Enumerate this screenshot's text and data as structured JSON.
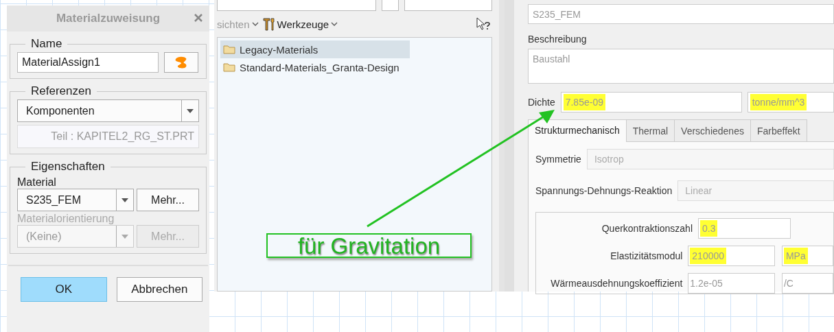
{
  "dialog": {
    "title": "Materialzuweisung",
    "name_group": {
      "legend": "Name",
      "value": "MaterialAssign1"
    },
    "references_group": {
      "legend": "Referenzen",
      "type": "Komponenten",
      "reference": "Teil : KAPITEL2_RG_ST.PRT"
    },
    "properties_group": {
      "legend": "Eigenschaften",
      "material_label": "Material",
      "material": "S235_FEM",
      "material_more": {
        "label": "Mehr...",
        "disabled": false
      },
      "orientation_label": "Materialorientierung",
      "orientation": "(Keine)",
      "orientation_disabled": true,
      "orientation_more": {
        "label": "Mehr...",
        "disabled": true
      }
    },
    "buttons": [
      {
        "label": "OK",
        "default": true
      },
      {
        "label": "Abbrechen",
        "default": false
      }
    ]
  },
  "browser": {
    "menus": [
      {
        "label": "sichten",
        "kind": "plain"
      },
      {
        "label": "Werkzeuge",
        "kind": "tools"
      }
    ],
    "items": [
      {
        "label": "Legacy-Materials",
        "selected": true
      },
      {
        "label": "Standard-Materials_Granta-Design",
        "selected": false
      }
    ]
  },
  "material": {
    "name": "S235_FEM",
    "description_label": "Beschreibung",
    "description": "Baustahl",
    "density": {
      "label": "Dichte",
      "value": "7.85e-09",
      "value_highlighted": true,
      "unit": "tonne/mm^3",
      "unit_highlighted": true
    },
    "tabs": [
      {
        "label": "Strukturmechanisch",
        "selected": true
      },
      {
        "label": "Thermal",
        "selected": false
      },
      {
        "label": "Verschiedenes",
        "selected": false
      },
      {
        "label": "Farbeffekt",
        "selected": false
      }
    ],
    "symmetry": {
      "label": "Symmetrie",
      "value": "Isotrop"
    },
    "response": {
      "label": "Spannungs-Dehnungs-Reaktion",
      "value": "Linear"
    },
    "parameters": [
      {
        "label": "Querkontraktionszahl",
        "value": "0.3",
        "value_highlighted": true
      },
      {
        "label": "Elastizitätsmodul",
        "value": "210000",
        "value_highlighted": true,
        "unit": "MPa",
        "unit_highlighted": true
      },
      {
        "label": "Wärmeausdehnungskoeffizient",
        "value": "1.2e-05",
        "value_highlighted": false,
        "unit": "/C",
        "unit_highlighted": false
      }
    ]
  },
  "annotation": {
    "text": "für Gravitation"
  }
}
